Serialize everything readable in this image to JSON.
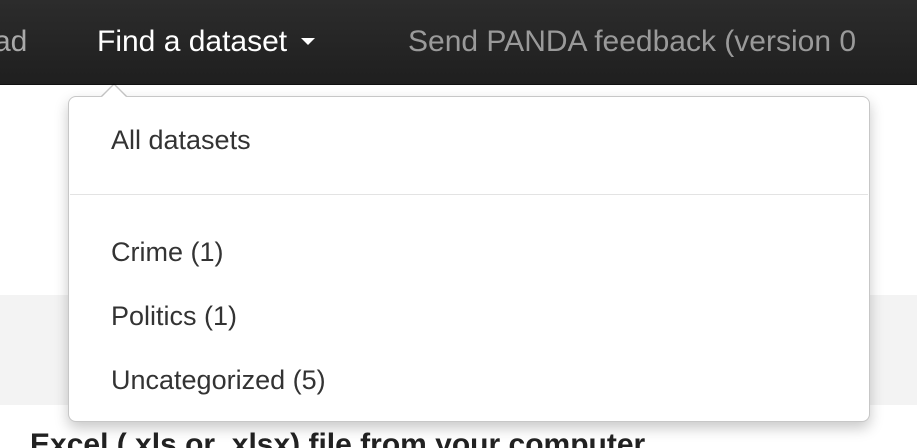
{
  "navbar": {
    "cut_item_label": "ad",
    "find_dataset_label": "Find a dataset",
    "feedback_label": "Send PANDA feedback (version 0"
  },
  "dropdown": {
    "all_datasets": "All datasets",
    "categories": [
      {
        "label": "Crime (1)"
      },
      {
        "label": "Politics (1)"
      },
      {
        "label": "Uncategorized (5)"
      }
    ]
  },
  "page": {
    "heading_partial": "Excel (.xls or .xlsx) file from your computer"
  }
}
